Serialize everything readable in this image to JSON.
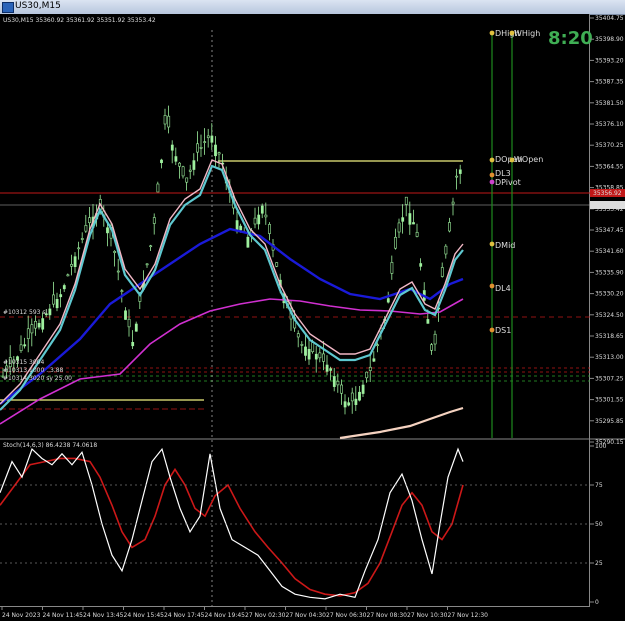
{
  "window": {
    "title": "US30,M15"
  },
  "chart_header": {
    "symbol_line": "US30,M15  35360.92 35361.92 35351.92 35353.42"
  },
  "timer": "8:20",
  "price_labels": [
    "35404.75",
    "35398.90",
    "35393.20",
    "35387.35",
    "35381.50",
    "35376.10",
    "35370.25",
    "35364.55",
    "35358.85",
    "35353.42",
    "35347.45",
    "35341.60",
    "35335.90",
    "35330.20",
    "35324.50",
    "35318.65",
    "35313.00",
    "35307.25",
    "35301.55",
    "35295.85",
    "35290.15"
  ],
  "current_price_tag": "35353.42",
  "red_price_tag": "35356.92",
  "stoch_header": "Stoch(14,6,3) 86.4238 74.0618",
  "stoch_levels": [
    "100",
    "75",
    "50",
    "25",
    "0"
  ],
  "time_labels": [
    "24 Nov 2023",
    "24 Nov 11:45",
    "24 Nov 13:45",
    "24 Nov 15:45",
    "24 Nov 17:45",
    "24 Nov 19:45",
    "27 Nov 02:30",
    "27 Nov 04:30",
    "27 Nov 06:30",
    "27 Nov 08:30",
    "27 Nov 10:30",
    "27 Nov 12:30"
  ],
  "level_markers": [
    {
      "label": "DHigh",
      "color": "#e0c040"
    },
    {
      "label": "WHigh",
      "color": "#e0c040"
    },
    {
      "label": "DOpen",
      "color": "#e0c040"
    },
    {
      "label": "WOpen",
      "color": "#e0c040"
    },
    {
      "label": "DL3",
      "color": "#e09030"
    },
    {
      "label": "DPivot",
      "color": "#cc44cc"
    },
    {
      "label": "DMid",
      "color": "#e0c040"
    },
    {
      "label": "DL4",
      "color": "#e09030"
    },
    {
      "label": "DS1",
      "color": "#e09030"
    }
  ],
  "left_annotations": [
    "#10312 593 sl",
    "#10315 3004",
    "#10313 1000 ..3.88",
    "#10314 3020 sy 25.00"
  ],
  "colors": {
    "bull_candle": "#9ef09e",
    "ema_fast": "#f2b8c6",
    "ema_mid": "#5ec8d0",
    "ema_slow": "#1a1ad8",
    "ema_200": "#d030d0",
    "ema_long": "#f5d2c0",
    "stoch_main": "#ffffff",
    "stoch_signal": "#cc1818",
    "green_vlines": "#1f8a1f",
    "yellow_level": "#f0f080"
  }
}
